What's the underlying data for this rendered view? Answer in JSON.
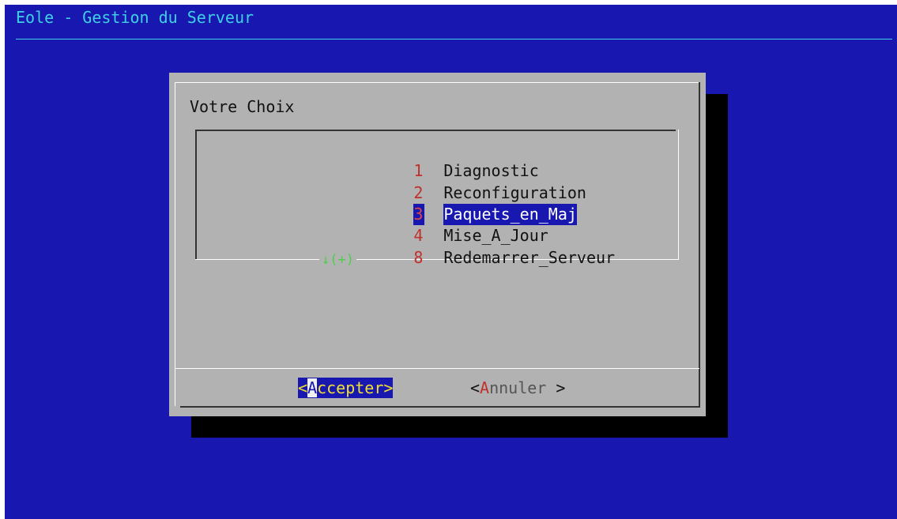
{
  "window": {
    "backtitle": "Eole - Gestion du Serveur"
  },
  "dialog": {
    "prompt": "Votre Choix",
    "menu": {
      "items": [
        {
          "tag": "1",
          "label": "Diagnostic",
          "selected": false
        },
        {
          "tag": "2",
          "label": "Reconfiguration",
          "selected": false
        },
        {
          "tag": "3",
          "label": "Paquets_en_Maj",
          "selected": true
        },
        {
          "tag": "4",
          "label": "Mise_A_Jour",
          "selected": false
        },
        {
          "tag": "8",
          "label": "Redemarrer_Serveur",
          "selected": false
        }
      ],
      "scroll_indicator": "↓(+)"
    },
    "buttons": {
      "accept": {
        "open": "<",
        "hotkey": "A",
        "rest": "ccepter",
        "close": ">"
      },
      "cancel": {
        "open": "<",
        "hotkey": "A",
        "rest": "nnuler",
        "close": " >"
      }
    }
  },
  "colors": {
    "background": "#1818b0",
    "dialog": "#b2b2b2",
    "backtitle": "#3fd0e6",
    "tag": "#c0302c",
    "selection": "#1818b0",
    "button_active_text": "#f0e030",
    "scroll_indicator": "#4cd04c",
    "shadow": "#000000"
  }
}
